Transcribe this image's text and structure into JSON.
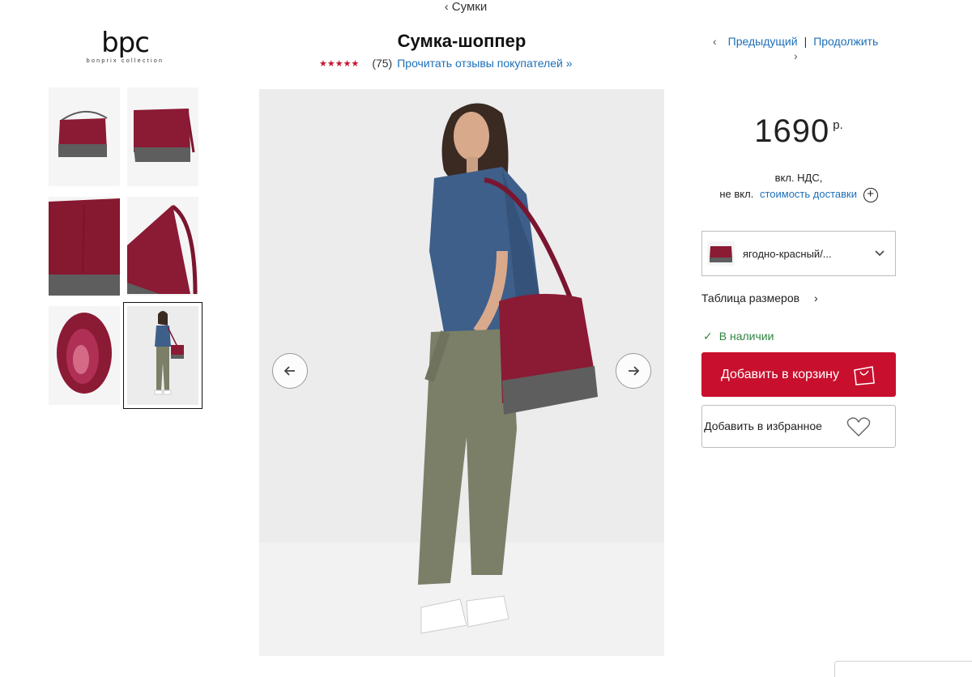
{
  "breadcrumb": {
    "label": "Сумки"
  },
  "logo": {
    "text": "bpc",
    "subtext": "bonprix collection"
  },
  "product": {
    "title": "Сумка-шоппер",
    "rating_count": "(75)",
    "reviews_link": "Прочитать отзывы покупателей »",
    "stars": 5
  },
  "nav": {
    "prev": "Предыдущий",
    "next": "Продолжить",
    "separator": "|"
  },
  "price": {
    "value": "1690",
    "currency": "р.",
    "vat": "вкл. НДС,",
    "shipping_prefix": "не вкл.",
    "shipping_link": "стоимость доставки"
  },
  "color_select": {
    "value": "ягодно-красный/..."
  },
  "size_table": {
    "label": "Таблица размеров"
  },
  "stock": {
    "label": "В наличии"
  },
  "buttons": {
    "add_to_cart": "Добавить в корзину",
    "add_to_wishlist": "Добавить в избранное"
  },
  "colors": {
    "accent": "#c8102e",
    "link": "#1d6fb8",
    "stock": "#2e8540",
    "bag": "#8b1a34",
    "bag_bottom": "#5e5e5e"
  }
}
